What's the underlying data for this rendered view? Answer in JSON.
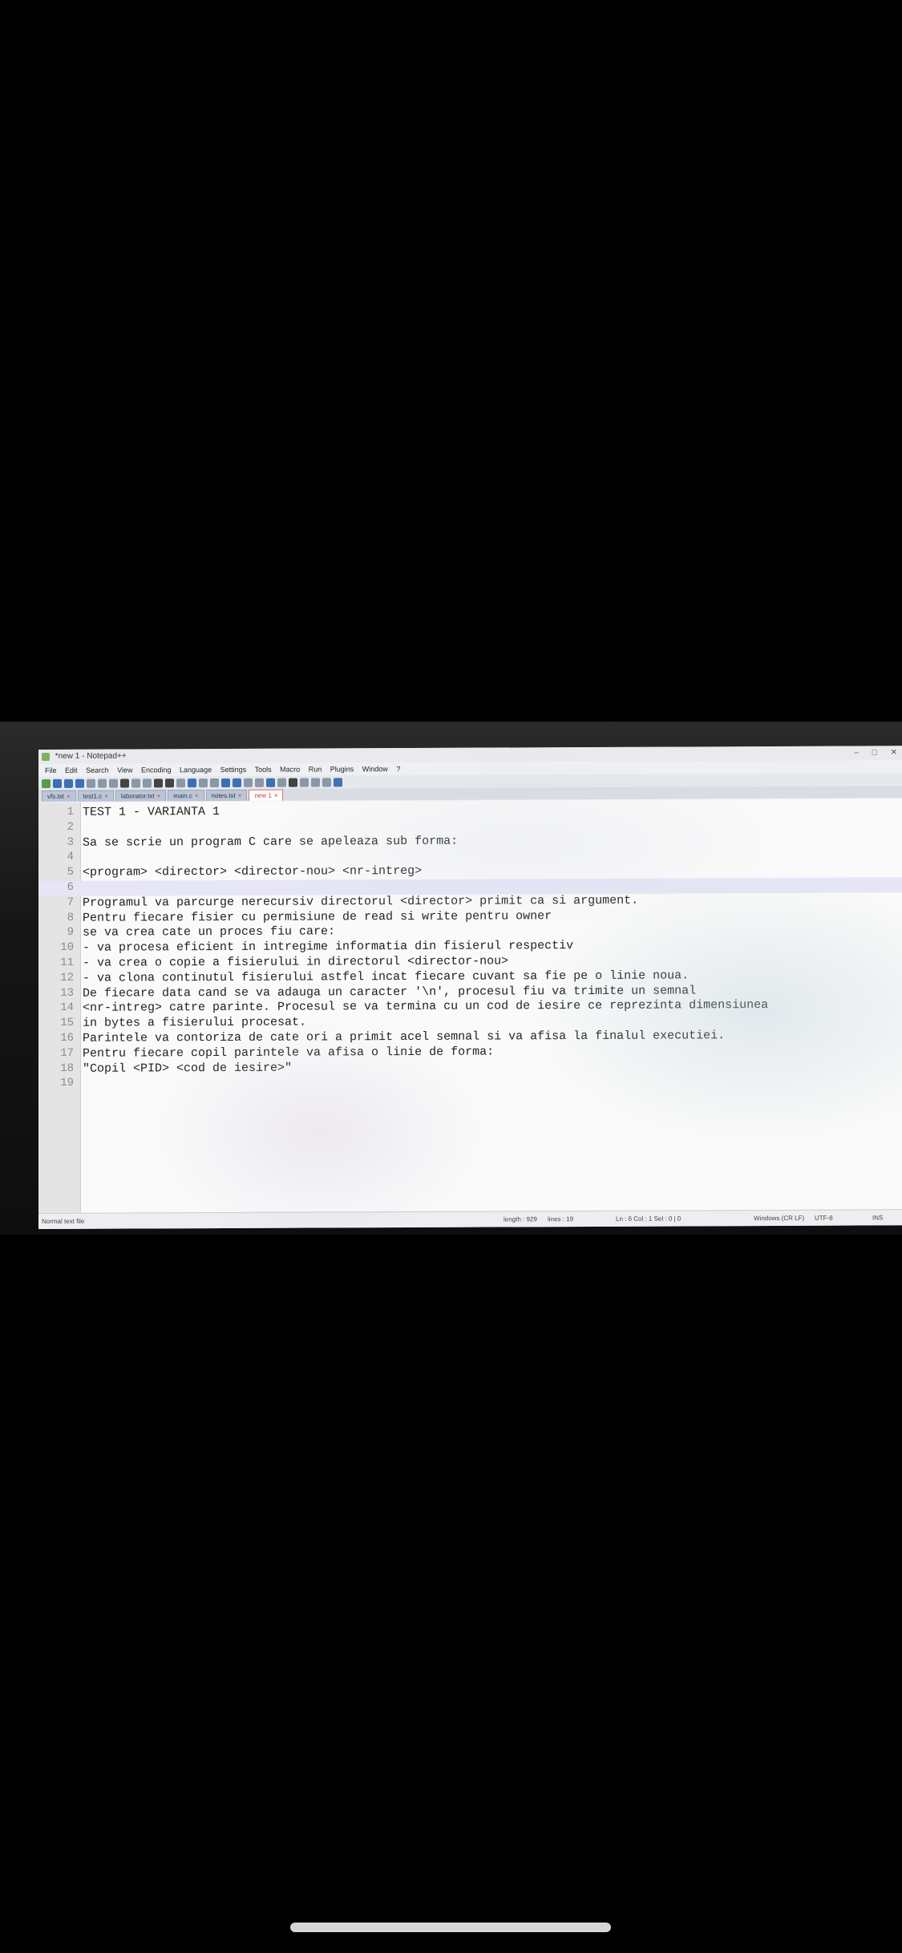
{
  "window": {
    "title": "*new 1 - Notepad++",
    "controls": [
      "–",
      "□",
      "✕"
    ]
  },
  "menu": [
    "File",
    "Edit",
    "Search",
    "View",
    "Encoding",
    "Language",
    "Settings",
    "Tools",
    "Macro",
    "Run",
    "Plugins",
    "Window",
    "?"
  ],
  "tabs": [
    {
      "label": "vfs.txt"
    },
    {
      "label": "test1.c"
    },
    {
      "label": "laborator.txt"
    },
    {
      "label": "main.c"
    },
    {
      "label": "notes.txt"
    },
    {
      "label": "new 1",
      "active": true
    }
  ],
  "editor": {
    "lines": [
      {
        "n": "1",
        "text": "TEST 1 - VARIANTA 1"
      },
      {
        "n": "2",
        "text": ""
      },
      {
        "n": "3",
        "text": "Sa se scrie un program C care se apeleaza sub forma:"
      },
      {
        "n": "4",
        "text": ""
      },
      {
        "n": "5",
        "text": "<program> <director> <director-nou> <nr-intreg>"
      },
      {
        "n": "6",
        "text": ""
      },
      {
        "n": "7",
        "text": "Programul va parcurge nerecursiv directorul <director> primit ca si argument."
      },
      {
        "n": "8",
        "text": "Pentru fiecare fisier cu permisiune de read si write pentru owner"
      },
      {
        "n": "9",
        "text": "se va crea cate un proces fiu care:"
      },
      {
        "n": "10",
        "text": "- va procesa eficient in intregime informatia din fisierul respectiv"
      },
      {
        "n": "11",
        "text": "- va crea o copie a fisierului in directorul <director-nou>"
      },
      {
        "n": "12",
        "text": "- va clona continutul fisierului astfel incat fiecare cuvant sa fie pe o linie noua."
      },
      {
        "n": "13",
        "text": "De fiecare data cand se va adauga un caracter '\\n', procesul fiu va trimite un semnal"
      },
      {
        "n": "14",
        "text": "<nr-intreg> catre parinte. Procesul se va termina cu un cod de iesire ce reprezinta dimensiunea"
      },
      {
        "n": "15",
        "text": "in bytes a fisierului procesat."
      },
      {
        "n": "16",
        "text": "Parintele va contoriza de cate ori a primit acel semnal si va afisa la finalul executiei."
      },
      {
        "n": "17",
        "text": "Pentru fiecare copil parintele va afisa o linie de forma:"
      },
      {
        "n": "18",
        "text": "\"Copil <PID> <cod de iesire>\""
      },
      {
        "n": "19",
        "text": ""
      }
    ],
    "current_line": 6
  },
  "status": {
    "file_type": "Normal text file",
    "length": "length : 929",
    "lines": "lines : 19",
    "position": "Ln : 6    Col : 1    Sel : 0 | 0",
    "eol": "Windows (CR LF)",
    "encoding": "UTF-8",
    "mode": "INS"
  }
}
